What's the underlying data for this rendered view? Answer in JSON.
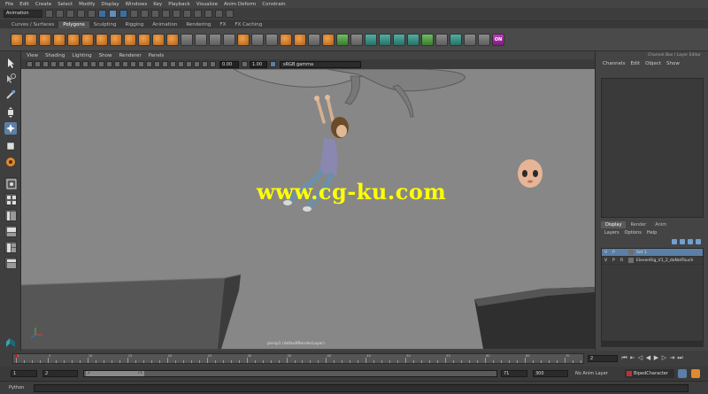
{
  "menubar": {
    "items": [
      "File",
      "Edit",
      "Create",
      "Select",
      "Modify",
      "Display",
      "Windows",
      "Key",
      "Playback",
      "Visualize",
      "Anim Deform",
      "Constrain"
    ]
  },
  "statusline": {
    "mode": "Animation"
  },
  "shelf": {
    "tabs": [
      "Curves / Surfaces",
      "Polygons",
      "Sculpting",
      "Rigging",
      "Animation",
      "Rendering",
      "FX",
      "FX Caching"
    ],
    "active_tab": "Polygons",
    "badge_label": "ON"
  },
  "panel": {
    "menu": [
      "View",
      "Shading",
      "Lighting",
      "Show",
      "Renderer",
      "Panels"
    ],
    "exposure": "0.00",
    "gamma": "1.00",
    "colorspace": "sRGB gamma"
  },
  "viewport": {
    "camera_label": "persp1 (defaultRenderLayer)",
    "watermark": "www.cg-ku.com"
  },
  "channelbox": {
    "title": "Channel Box / Layer Editor",
    "menu": [
      "Channels",
      "Edit",
      "Object",
      "Show"
    ]
  },
  "layereditor": {
    "tabs": [
      "Display",
      "Render",
      "Anim"
    ],
    "active_tab": "Display",
    "menu": [
      "Layers",
      "Options",
      "Help"
    ],
    "layers": [
      {
        "v": "V",
        "p": "P",
        "r": "",
        "name": "Set 1",
        "selected": true
      },
      {
        "v": "V",
        "p": "P",
        "r": "R",
        "name": "ElevenRig_V1_2_doNotTouch",
        "selected": false
      }
    ]
  },
  "timeslider": {
    "ticks": [
      "1",
      "5",
      "10",
      "15",
      "20",
      "25",
      "30",
      "35",
      "40",
      "45",
      "50",
      "55",
      "60",
      "65",
      "70"
    ],
    "current_frame": "2"
  },
  "rangeslider": {
    "start": "1",
    "playback_start": "2",
    "range_start_label": "2",
    "range_end_label": "71",
    "playback_end": "71",
    "end": "300",
    "anim_layer": "No Anim Layer",
    "character_set": "BipedCharacter"
  },
  "cmdline": {
    "language": "Python"
  },
  "colors": {
    "accent_blue": "#5b7fa6",
    "orange_icon": "#e08a2e",
    "watermark_yellow": "#ffff00",
    "viewport_bg": "#878787"
  }
}
